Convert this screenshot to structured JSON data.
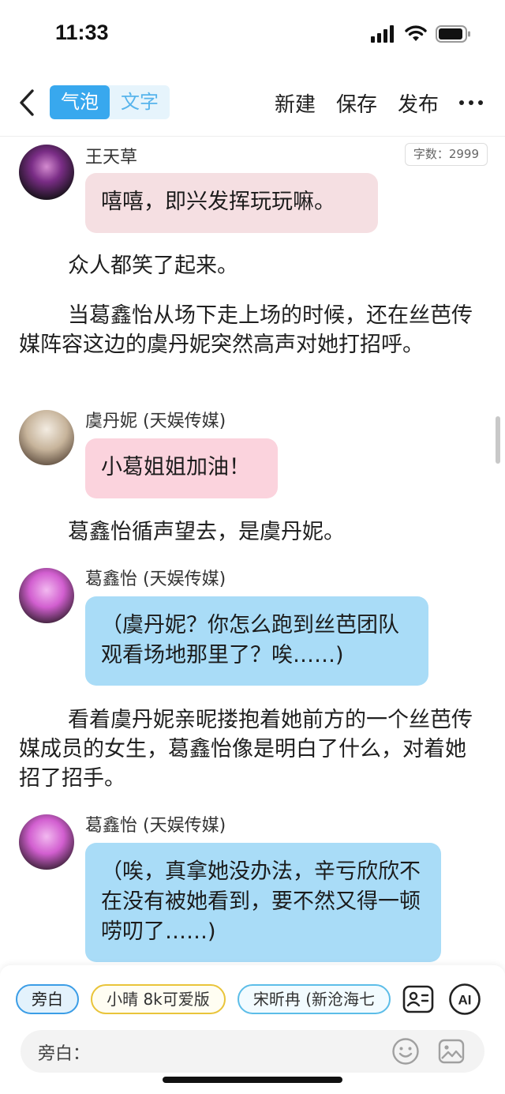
{
  "status": {
    "time": "11:33"
  },
  "nav": {
    "mode_bubble": "气泡",
    "mode_text": "文字",
    "actions": [
      "新建",
      "保存",
      "发布"
    ]
  },
  "word_count": "字数：2999",
  "messages": [
    {
      "speaker": "王天草",
      "text": "嘻嘻，即兴发挥玩玩嘛。",
      "bubble_color": "#f5dfe2",
      "avatar_colors": [
        "#2a1c2e",
        "#b04ab0"
      ]
    },
    {
      "speaker": "虞丹妮 (天娱传媒)",
      "text": "小葛姐姐加油！",
      "bubble_color": "#fbd3dd",
      "avatar_colors": [
        "#c9b9a6",
        "#ffffff"
      ]
    },
    {
      "speaker": "葛鑫怡 (天娱传媒)",
      "text": "（虞丹妮？你怎么跑到丝芭团队观看场地那里了？唉……)",
      "bubble_color": "#a9dcf7",
      "avatar_colors": [
        "#e07ae0",
        "#24141e"
      ]
    },
    {
      "speaker": "葛鑫怡 (天娱传媒)",
      "text": "（唉，真拿她没办法，辛亏欣欣不在没有被她看到，要不然又得一顿唠叨了……)",
      "bubble_color": "#a9dcf7",
      "avatar_colors": [
        "#e07ae0",
        "#24141e"
      ]
    }
  ],
  "narrations": [
    "众人都笑了起来。",
    "当葛鑫怡从场下走上场的时候，还在丝芭传媒阵容这边的虞丹妮突然高声对她打招呼。",
    "葛鑫怡循声望去，是虞丹妮。",
    "看着虞丹妮亲昵搂抱着她前方的一个丝芭传媒成员的女生，葛鑫怡像是明白了什么，对着她招了招手。"
  ],
  "chips": [
    "旁白",
    "小晴 8k可爱版",
    "宋昕冉 (新沧海七"
  ],
  "input": {
    "label": "旁白：",
    "placeholder": ""
  },
  "icons": {
    "back": "chevron-left-icon",
    "more": "more-dots-icon",
    "role": "contact-card-icon",
    "ai": "ai-icon",
    "emoji": "smiley-icon",
    "image": "image-icon"
  }
}
